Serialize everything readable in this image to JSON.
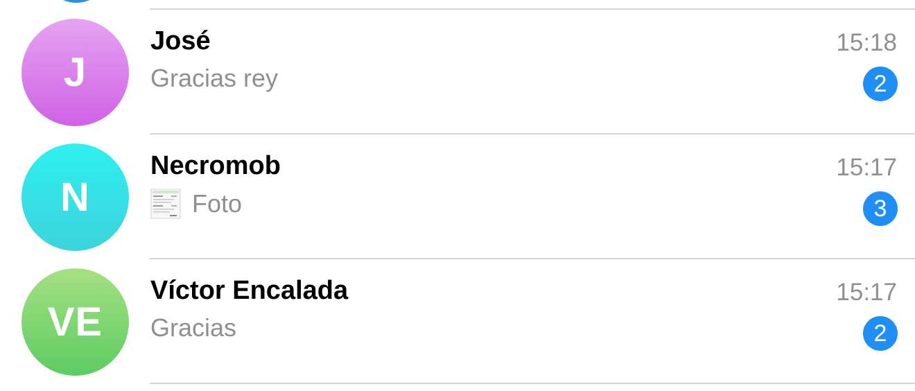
{
  "chats": [
    {
      "initials": "J",
      "name": "José",
      "preview": "Gracias rey",
      "time": "15:18",
      "unread": "2",
      "avatar_colors": [
        "#e6a3f0",
        "#d061e6"
      ]
    },
    {
      "initials": "N",
      "name": "Necromob",
      "preview": "Foto",
      "preview_icon": "photo-thumbnail-icon",
      "time": "15:17",
      "unread": "3",
      "avatar_colors": [
        "#2ef0f0",
        "#3cd3dc"
      ]
    },
    {
      "initials": "VE",
      "name": "Víctor Encalada",
      "preview": "Gracias",
      "time": "15:17",
      "unread": "2",
      "avatar_colors": [
        "#a6e083",
        "#5ccc62"
      ]
    }
  ],
  "colors": {
    "badge": "#1f8ff5",
    "separator": "#d6d6da",
    "secondary_text": "#8e8e93",
    "previous_avatar_edge": "#2c8fd8"
  }
}
